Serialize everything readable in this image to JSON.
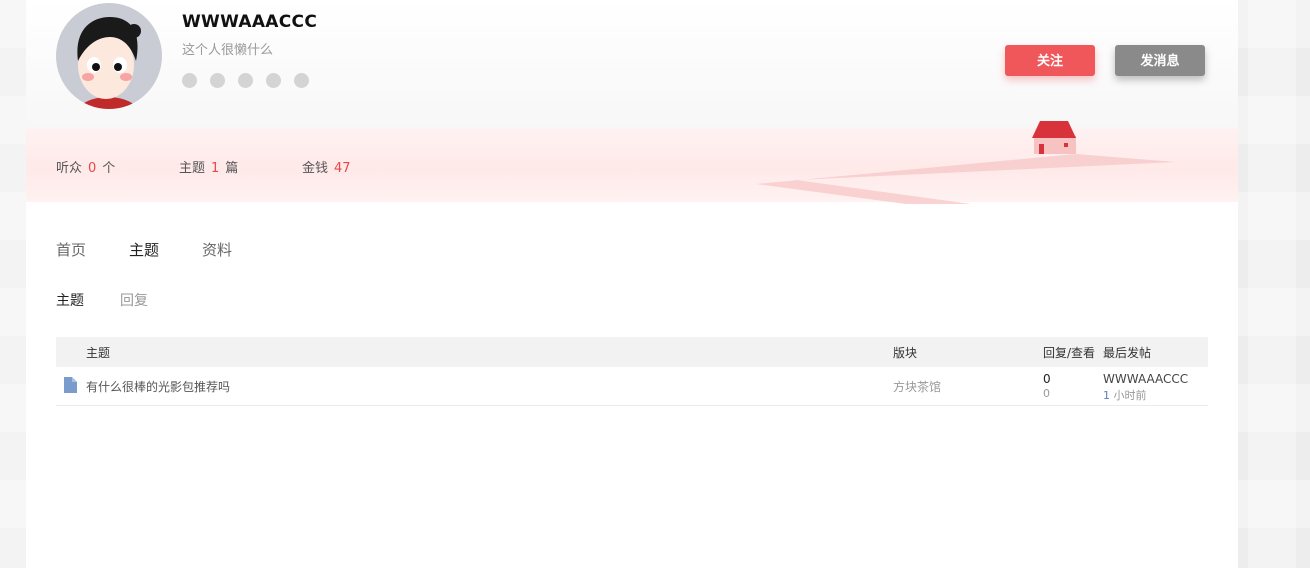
{
  "profile": {
    "username": "WWWAAACCC",
    "bio": "这个人很懒什么",
    "social_icons": [
      "github-icon",
      "weibo-icon",
      "wechat-icon",
      "qq-icon",
      "close-icon"
    ]
  },
  "actions": {
    "follow_label": "关注",
    "message_label": "发消息"
  },
  "stats": {
    "listeners": {
      "label": "听众",
      "value": "0",
      "unit": "个"
    },
    "topics": {
      "label": "主题",
      "value": "1",
      "unit": "篇"
    },
    "money": {
      "label": "金钱",
      "value": "47"
    }
  },
  "tabs": [
    "首页",
    "主题",
    "资料"
  ],
  "subtabs": [
    "主题",
    "回复"
  ],
  "table": {
    "headers": {
      "topic": "主题",
      "board": "版块",
      "stats": "回复/查看",
      "last_post": "最后发帖"
    },
    "rows": [
      {
        "title": "有什么很棒的光影包推荐吗",
        "board": "方块茶馆",
        "replies": "0",
        "views": "0",
        "last_user": "WWWAAACCC",
        "last_time_num": "1",
        "last_time_unit": "小时前"
      }
    ]
  },
  "colors": {
    "accent": "#f0575a",
    "number": "#e84848",
    "secondary_button": "#8a8a8a"
  }
}
